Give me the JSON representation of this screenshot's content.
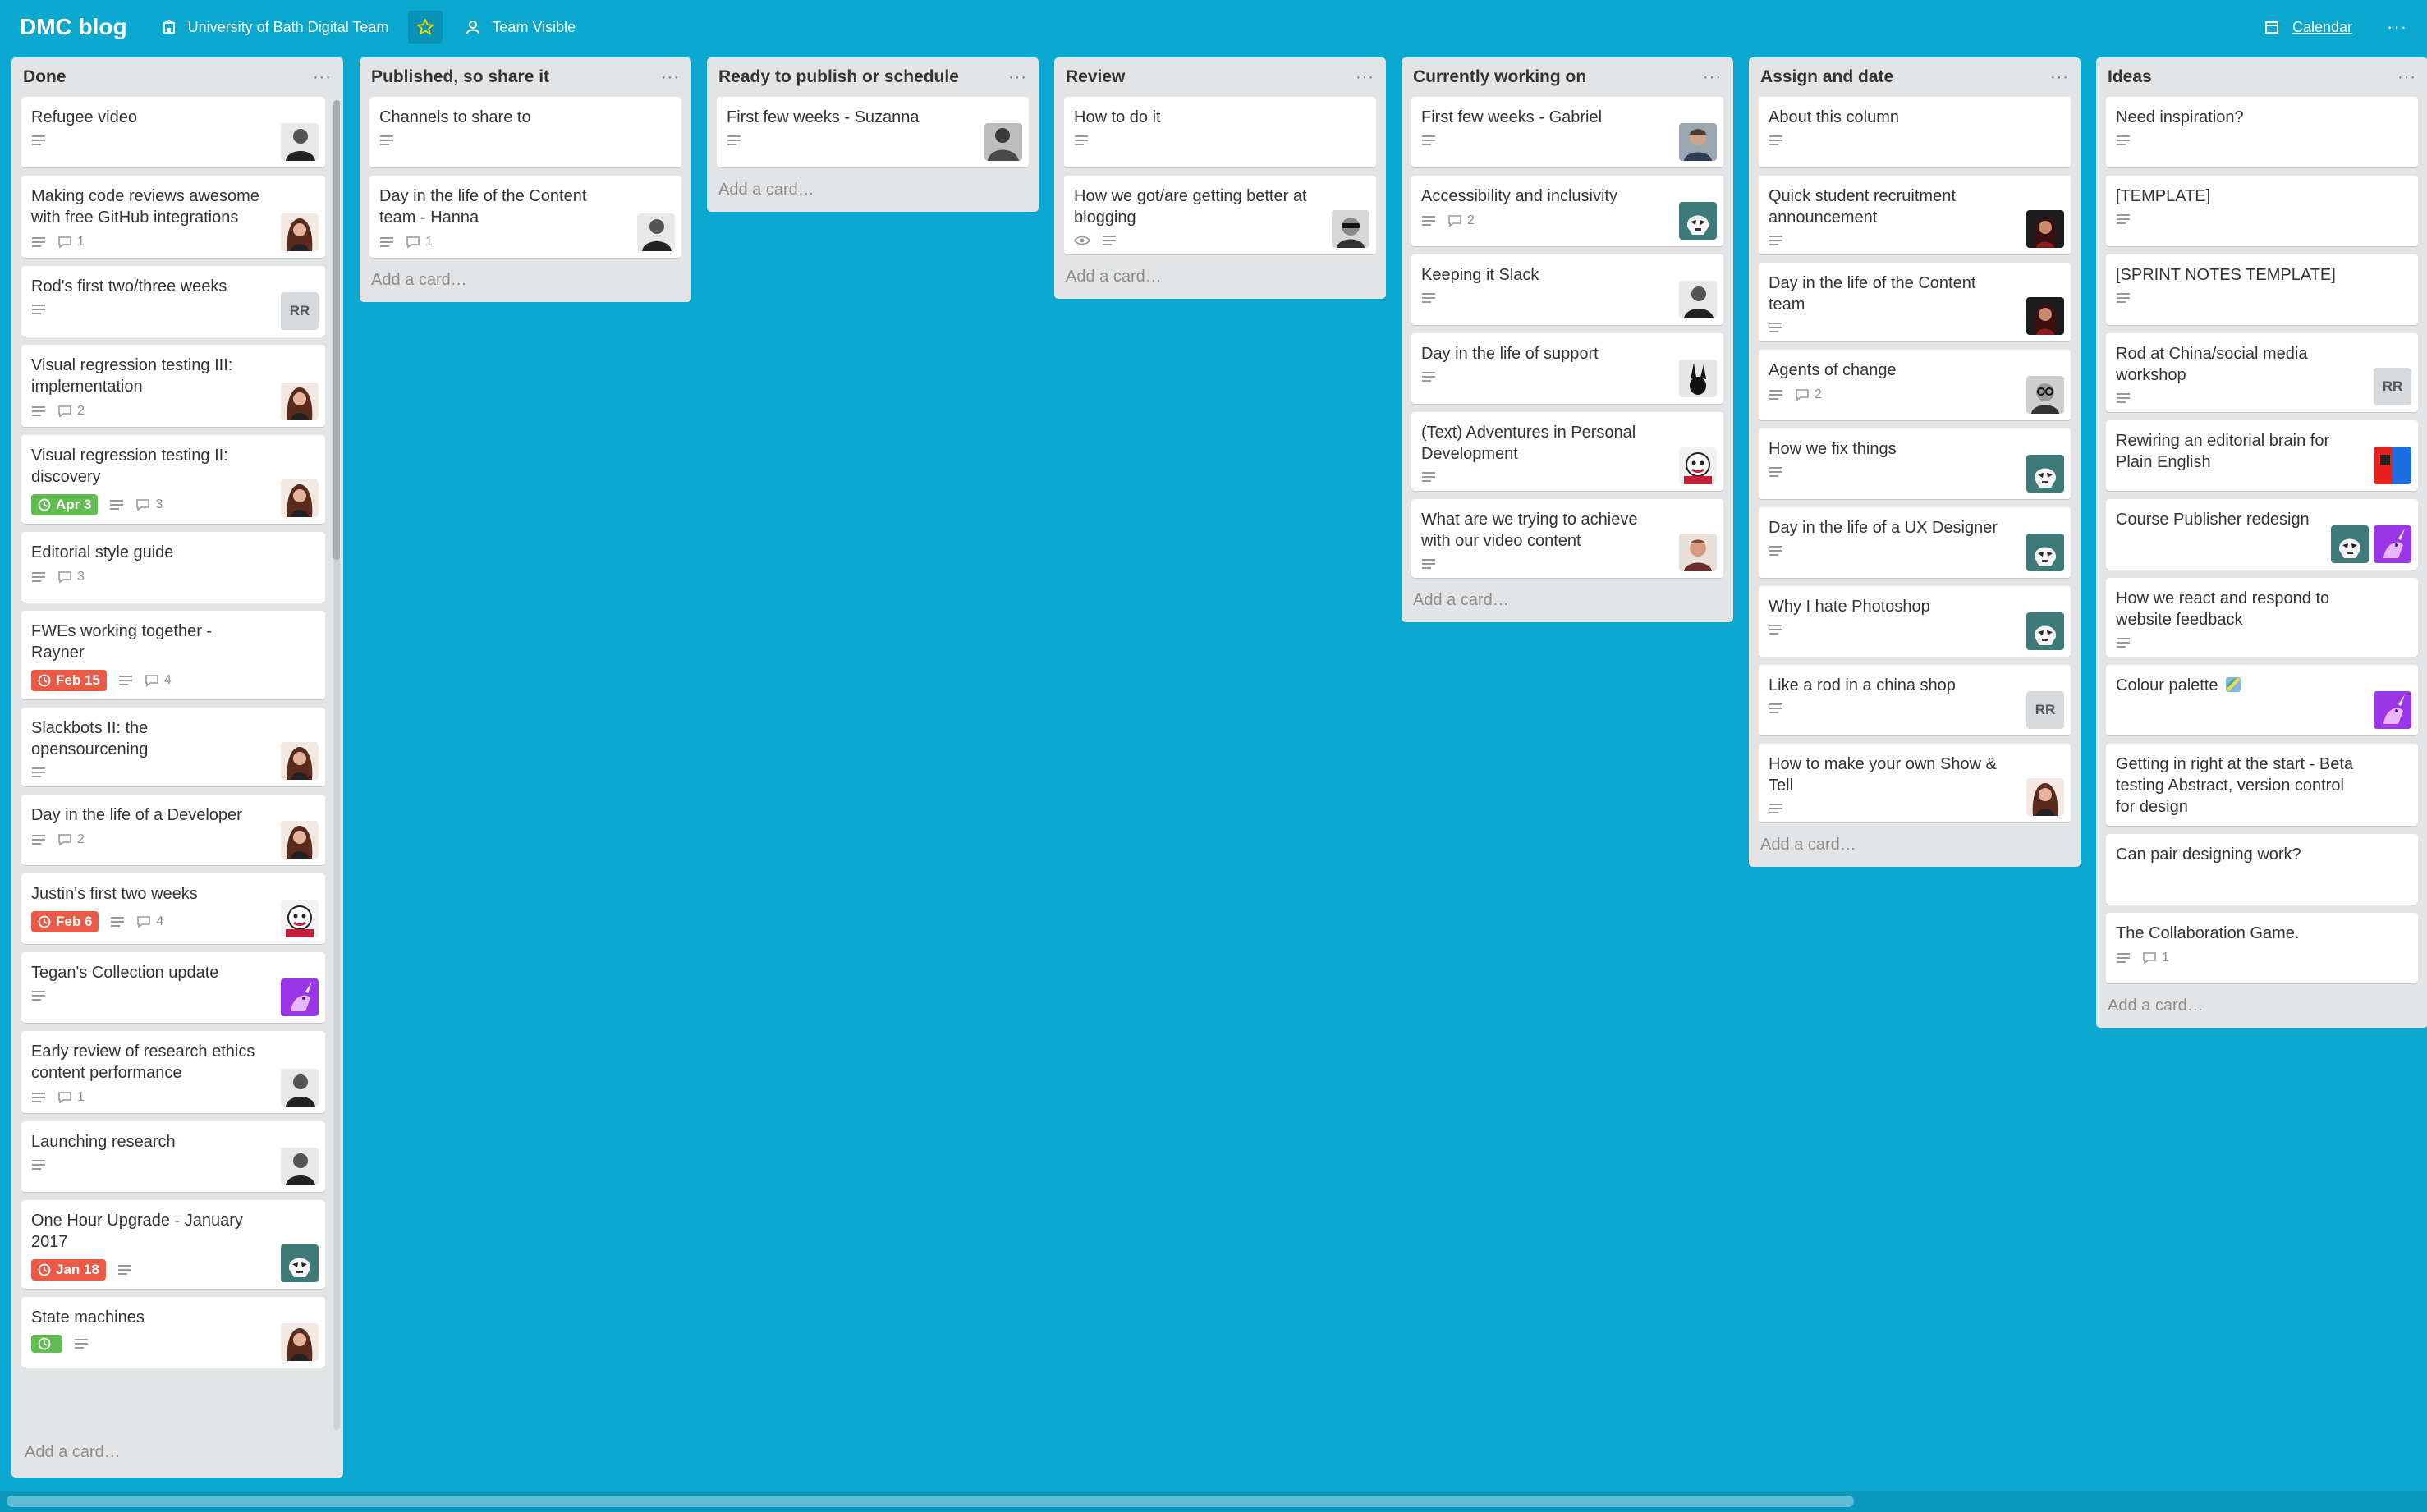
{
  "header": {
    "title": "DMC blog",
    "team": "University of Bath Digital Team",
    "visibility": "Team Visible",
    "calendar": "Calendar",
    "more": "···"
  },
  "colors": {
    "board_bg": "#0aa7cf",
    "due_green": "#61bd4f",
    "due_red": "#eb5a46",
    "star": "#f2d600"
  },
  "add_card_label": "Add a card…",
  "list_menu_label": "···",
  "lists": [
    {
      "title": "Done",
      "cards": [
        {
          "title": "Refugee video",
          "desc": true,
          "members": [
            "photo-bw-man"
          ]
        },
        {
          "title": "Making code reviews awesome with free GitHub integrations",
          "desc": true,
          "comments": "1",
          "members": [
            "photo-woman"
          ]
        },
        {
          "title": "Rod's first two/three weeks",
          "desc": true,
          "members": [
            "RR"
          ]
        },
        {
          "title": "Visual regression testing III: implementation",
          "desc": true,
          "comments": "2",
          "members": [
            "photo-woman"
          ]
        },
        {
          "title": "Visual regression testing II: discovery",
          "due": "Apr 3",
          "due_color": "green",
          "desc": true,
          "comments": "3",
          "members": [
            "photo-woman"
          ]
        },
        {
          "title": "Editorial style guide",
          "desc": true,
          "comments": "3",
          "members": []
        },
        {
          "title": "FWEs working together - Rayner",
          "due": "Feb 15",
          "due_color": "red",
          "desc": true,
          "comments": "4",
          "members": []
        },
        {
          "title": "Slackbots II: the opensourcening",
          "desc": true,
          "members": [
            "photo-woman"
          ]
        },
        {
          "title": "Day in the life of a Developer",
          "desc": true,
          "comments": "2",
          "members": [
            "photo-woman"
          ]
        },
        {
          "title": "Justin's first two weeks",
          "due": "Feb 6",
          "due_color": "red",
          "desc": true,
          "comments": "4",
          "members": [
            "photo-cartoon"
          ]
        },
        {
          "title": "Tegan's Collection update",
          "desc": true,
          "members": [
            "unicorn-purple"
          ]
        },
        {
          "title": "Early review of research ethics content performance",
          "desc": true,
          "comments": "1",
          "members": [
            "photo-bw-man"
          ]
        },
        {
          "title": "Launching research",
          "desc": true,
          "members": [
            "photo-bw-man"
          ]
        },
        {
          "title": "One Hour Upgrade - January 2017",
          "due": "Jan 18",
          "due_color": "red",
          "desc": true,
          "members": [
            "stormtrooper"
          ]
        },
        {
          "title": "State machines",
          "due": "",
          "due_color": "green",
          "desc": true,
          "members": [
            "photo-woman"
          ]
        }
      ]
    },
    {
      "title": "Published, so share it",
      "cards": [
        {
          "title": "Channels to share to",
          "desc": true,
          "members": []
        },
        {
          "title": "Day in the life of the Content team - Hanna",
          "desc": true,
          "comments": "1",
          "members": [
            "photo-bw-man"
          ]
        }
      ]
    },
    {
      "title": "Ready to publish or schedule",
      "cards": [
        {
          "title": "First few weeks - Suzanna",
          "desc": true,
          "members": [
            "photo-bw-man2"
          ]
        }
      ]
    },
    {
      "title": "Review",
      "cards": [
        {
          "title": "How to do it",
          "desc": true,
          "members": []
        },
        {
          "title": "How we got/are getting better at blogging",
          "watch": true,
          "desc": true,
          "members": [
            "photo-sunglasses"
          ]
        }
      ]
    },
    {
      "title": "Currently working on",
      "cards": [
        {
          "title": "First few weeks - Gabriel",
          "desc": true,
          "members": [
            "photo-man"
          ]
        },
        {
          "title": "Accessibility and inclusivity",
          "desc": true,
          "comments": "2",
          "members": [
            "stormtrooper"
          ]
        },
        {
          "title": "Keeping it Slack",
          "desc": true,
          "members": [
            "photo-bw-man"
          ]
        },
        {
          "title": "Day in the life of support",
          "desc": true,
          "members": [
            "rabbit"
          ]
        },
        {
          "title": "(Text) Adventures in Personal Development",
          "desc": true,
          "members": [
            "photo-cartoon"
          ]
        },
        {
          "title": "What are we trying to achieve with our video content",
          "desc": true,
          "members": [
            "photo-red-man"
          ]
        }
      ]
    },
    {
      "title": "Assign and date",
      "cards": [
        {
          "title": "About this column",
          "desc": true,
          "members": []
        },
        {
          "title": "Quick student recruitment announcement",
          "desc": true,
          "members": [
            "photo-dark-woman"
          ]
        },
        {
          "title": "Day in the life of the Content team",
          "desc": true,
          "members": [
            "photo-dark-woman"
          ]
        },
        {
          "title": "Agents of change",
          "desc": true,
          "comments": "2",
          "members": [
            "photo-glasses"
          ]
        },
        {
          "title": "How we fix things",
          "desc": true,
          "members": [
            "stormtrooper"
          ]
        },
        {
          "title": "Day in the life of a UX Designer",
          "desc": true,
          "members": [
            "stormtrooper"
          ]
        },
        {
          "title": "Why I hate Photoshop",
          "desc": true,
          "members": [
            "stormtrooper"
          ]
        },
        {
          "title": "Like a rod in a china shop",
          "desc": true,
          "members": [
            "RR"
          ]
        },
        {
          "title": "How to make your own Show & Tell",
          "desc": true,
          "members": [
            "photo-woman"
          ]
        }
      ]
    },
    {
      "title": "Ideas",
      "cards": [
        {
          "title": "Need inspiration?",
          "desc": true,
          "members": []
        },
        {
          "title": "[TEMPLATE]",
          "desc": true,
          "members": []
        },
        {
          "title": "[SPRINT NOTES TEMPLATE]",
          "desc": true,
          "members": []
        },
        {
          "title": "Rod at China/social media workshop",
          "desc": true,
          "members": [
            "RR"
          ]
        },
        {
          "title": "Rewiring an editorial brain for Plain English",
          "members": [
            "red-blue"
          ]
        },
        {
          "title": "Course Publisher redesign",
          "members": [
            "stormtrooper",
            "unicorn-purple"
          ]
        },
        {
          "title": "How we react and respond to website feedback",
          "desc": true,
          "members": []
        },
        {
          "title": "Colour palette",
          "emoji": true,
          "members": [
            "unicorn-purple"
          ]
        },
        {
          "title": "Getting in right at the start - Beta testing Abstract, version control for design",
          "members": []
        },
        {
          "title": "Can pair designing work?",
          "members": []
        },
        {
          "title": "The Collaboration Game.",
          "desc": true,
          "comments": "1",
          "members": []
        }
      ]
    }
  ]
}
